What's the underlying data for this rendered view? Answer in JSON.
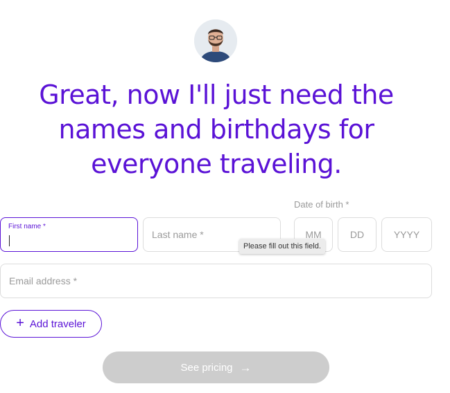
{
  "headline": {
    "line1": "Great, now I'll just need the",
    "line2": "names and birthdays for",
    "line3": "everyone traveling."
  },
  "form": {
    "first_name": {
      "label": "First name *",
      "value": ""
    },
    "last_name": {
      "placeholder": "Last name *"
    },
    "dob": {
      "label": "Date of birth *",
      "month_placeholder": "MM",
      "day_placeholder": "DD",
      "year_placeholder": "YYYY"
    },
    "email": {
      "placeholder": "Email address *"
    },
    "validation_tooltip": "Please fill out this field."
  },
  "buttons": {
    "add_traveler": "Add traveler",
    "add_icon": "+",
    "see_pricing": "See pricing",
    "arrow_icon": "→"
  },
  "colors": {
    "accent": "#5a12d6",
    "border": "#dcdcdc",
    "disabled_button": "#cdcdcd",
    "placeholder": "#9a9a9a"
  },
  "icons": [
    "avatar",
    "plus-icon",
    "arrow-right-icon"
  ]
}
